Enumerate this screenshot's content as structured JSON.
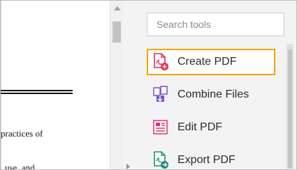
{
  "document": {
    "text_line_1": "practices of",
    "text_line_2": "use, and"
  },
  "tools_panel": {
    "search": {
      "placeholder": "Search tools",
      "value": ""
    },
    "tools": [
      {
        "label": "Create PDF",
        "icon": "create-pdf-icon",
        "color": "#e0304e",
        "selected": true
      },
      {
        "label": "Combine Files",
        "icon": "combine-files-icon",
        "color": "#7b4fd6",
        "selected": false
      },
      {
        "label": "Edit PDF",
        "icon": "edit-pdf-icon",
        "color": "#e0307a",
        "selected": false
      },
      {
        "label": "Export PDF",
        "icon": "export-pdf-icon",
        "color": "#1e8f7e",
        "selected": false
      }
    ],
    "highlight_color": "#f0a30a"
  }
}
